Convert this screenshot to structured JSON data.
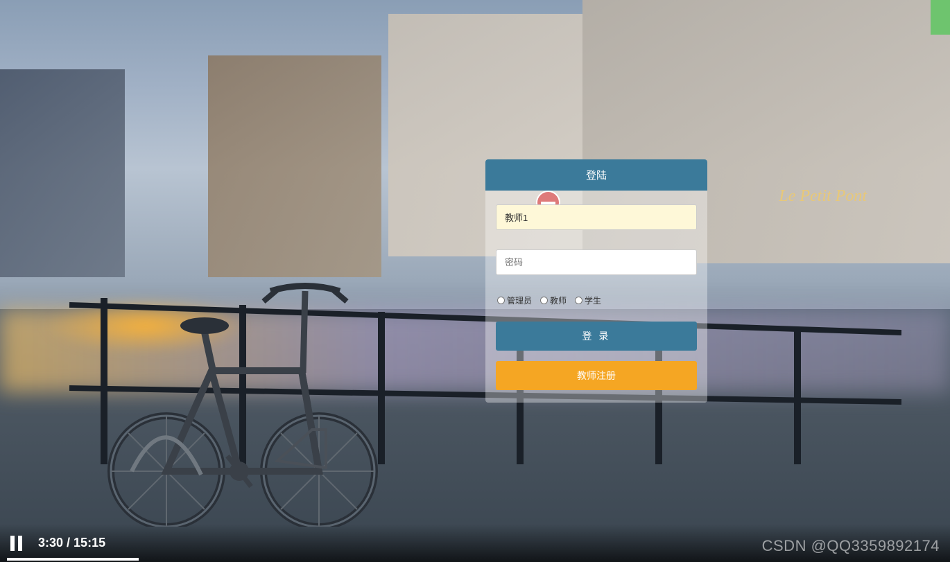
{
  "login": {
    "header_title": "登陆",
    "username_value": "教师1",
    "password_placeholder": "密码",
    "roles": {
      "admin": "管理员",
      "teacher": "教师",
      "student": "学生"
    },
    "login_button_label": "登 录",
    "register_button_label": "教师注册"
  },
  "video": {
    "current_time": "3:30",
    "total_time": "15:15",
    "separator": " / "
  },
  "watermark": "CSDN @QQ3359892174",
  "scene": {
    "store_sign": "Le Petit Pont"
  }
}
